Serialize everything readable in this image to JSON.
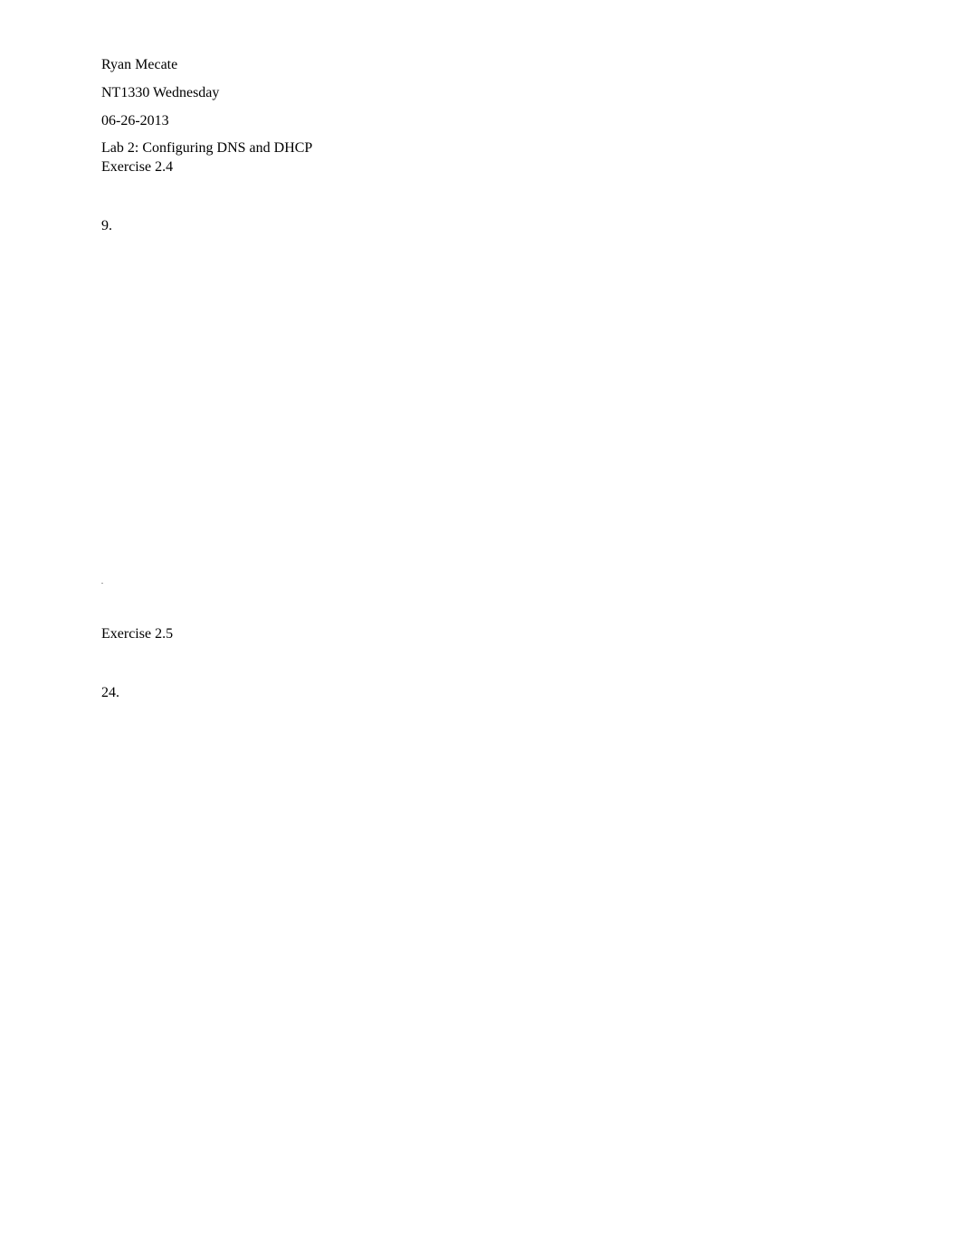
{
  "header": {
    "author": "Ryan Mecate",
    "course": "NT1330 Wednesday",
    "date": "06-26-2013",
    "lab_title": "Lab 2: Configuring DNS and DHCP"
  },
  "sections": [
    {
      "label": "Exercise 2.4",
      "step": "9."
    },
    {
      "label": "Exercise 2.5",
      "step": "24."
    }
  ],
  "dot": "."
}
